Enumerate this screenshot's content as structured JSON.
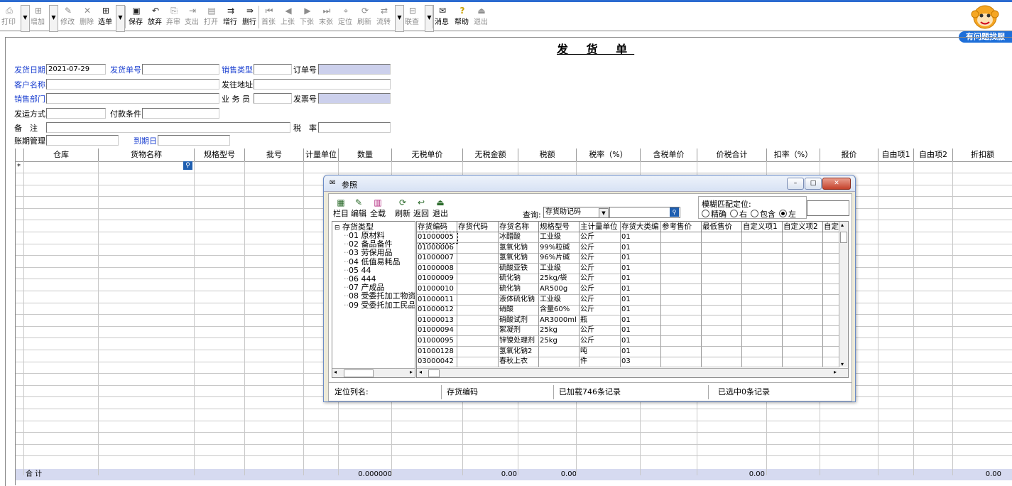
{
  "toolbar": {
    "buttons": [
      {
        "id": "print",
        "label": "打印",
        "icon": "printer-icon",
        "enabled": false
      },
      {
        "id": "add",
        "label": "增加",
        "icon": "add-doc-icon",
        "enabled": false
      },
      {
        "id": "modify",
        "label": "修改",
        "icon": "edit-icon",
        "enabled": false
      },
      {
        "id": "delete",
        "label": "删除",
        "icon": "delete-icon",
        "enabled": false
      },
      {
        "id": "select",
        "label": "选单",
        "icon": "select-icon",
        "enabled": true
      },
      {
        "id": "save",
        "label": "保存",
        "icon": "save-icon",
        "enabled": true
      },
      {
        "id": "abandon",
        "label": "放弃",
        "icon": "undo-icon",
        "enabled": true
      },
      {
        "id": "abandon_audit",
        "label": "弃审",
        "icon": "unaudit-icon",
        "enabled": false
      },
      {
        "id": "pay",
        "label": "支出",
        "icon": "pay-icon",
        "enabled": false
      },
      {
        "id": "open",
        "label": "打开",
        "icon": "open-icon",
        "enabled": false
      },
      {
        "id": "add_row",
        "label": "增行",
        "icon": "add-row-icon",
        "enabled": true
      },
      {
        "id": "del_row",
        "label": "删行",
        "icon": "del-row-icon",
        "enabled": true
      },
      {
        "id": "first",
        "label": "首张",
        "icon": "first-icon",
        "enabled": false
      },
      {
        "id": "prev",
        "label": "上张",
        "icon": "prev-icon",
        "enabled": false
      },
      {
        "id": "next",
        "label": "下张",
        "icon": "next-icon",
        "enabled": false
      },
      {
        "id": "last",
        "label": "末张",
        "icon": "last-icon",
        "enabled": false
      },
      {
        "id": "locate",
        "label": "定位",
        "icon": "locate-icon",
        "enabled": false
      },
      {
        "id": "refresh",
        "label": "刷新",
        "icon": "refresh-icon",
        "enabled": false
      },
      {
        "id": "flow",
        "label": "流转",
        "icon": "flow-icon",
        "enabled": false
      },
      {
        "id": "link",
        "label": "联查",
        "icon": "link-query-icon",
        "enabled": false
      },
      {
        "id": "message",
        "label": "消息",
        "icon": "message-icon",
        "enabled": true
      },
      {
        "id": "help",
        "label": "帮助",
        "icon": "help-icon",
        "enabled": true
      },
      {
        "id": "exit",
        "label": "退出",
        "icon": "exit-icon",
        "enabled": false
      }
    ],
    "help_link": "有问题找服"
  },
  "form": {
    "title": "发 货 单",
    "fields": {
      "ship_date_label": "发货日期",
      "ship_date": "2021-07-29",
      "ship_no_label": "发货单号",
      "sales_type_label": "销售类型",
      "order_no_label": "订单号",
      "customer_label": "客户名称",
      "ship_addr_label": "发往地址",
      "sales_dept_label": "销售部门",
      "salesman_label": "业 务 员",
      "invoice_no_label": "发票号",
      "ship_method_label": "发运方式",
      "pay_terms_label": "付款条件",
      "remark_label": "备　注",
      "tax_rate_label": "税　率",
      "period_mgmt_label": "账期管理",
      "due_date_label": "到期日"
    }
  },
  "grid": {
    "columns": [
      "仓库",
      "货物名称",
      "规格型号",
      "批号",
      "计量单位",
      "数量",
      "无税单价",
      "无税金额",
      "税额",
      "税率（%）",
      "含税单价",
      "价税合计",
      "扣率（%）",
      "报价",
      "自由项1",
      "自由项2",
      "折扣额"
    ],
    "new_row_marker": "*",
    "total_label": "合 计",
    "totals": {
      "qty": "0.000000",
      "amount": "0.00",
      "tax": "0.00",
      "total": "0.00",
      "discount": "0.00"
    }
  },
  "dialog": {
    "title": "参照",
    "toolbar": [
      {
        "label": "栏目",
        "icon": "columns-icon"
      },
      {
        "label": "编辑",
        "icon": "edit-icon"
      },
      {
        "label": "全载",
        "icon": "load-all-icon"
      },
      {
        "label": "刷新",
        "icon": "refresh-icon"
      },
      {
        "label": "返回",
        "icon": "return-icon"
      },
      {
        "label": "退出",
        "icon": "exit-icon"
      }
    ],
    "query_label": "查询:",
    "query_select": "存货助记码",
    "fuzzy_label": "模糊匹配定位:",
    "radio_options": [
      "精确",
      "右",
      "包含",
      "左"
    ],
    "radio_selected": "左",
    "tree": {
      "root": "存货类型",
      "items": [
        "01 原材料",
        "02 备品备件",
        "03 劳保用品",
        "04 低值易耗品",
        "05 44",
        "06 444",
        "07 产成品",
        "08 受委托加工物资",
        "09 受委托加工民品"
      ]
    },
    "columns": [
      "存货编码",
      "存货代码",
      "存货名称",
      "规格型号",
      "主计量单位",
      "存货大类编",
      "参考售价",
      "最低售价",
      "自定义项1",
      "自定义项2",
      "自定"
    ],
    "rows": [
      [
        "01000005",
        "",
        "冰醋酸",
        "工业级",
        "公斤",
        "01"
      ],
      [
        "01000006",
        "",
        "氢氧化钠",
        "99%粒碱",
        "公斤",
        "01"
      ],
      [
        "01000007",
        "",
        "氢氧化钠",
        "96%片碱",
        "公斤",
        "01"
      ],
      [
        "01000008",
        "",
        "硫酸亚铁",
        "工业级",
        "公斤",
        "01"
      ],
      [
        "01000009",
        "",
        "硫化钠",
        "25kg/袋",
        "公斤",
        "01"
      ],
      [
        "01000010",
        "",
        "硫化钠",
        "AR500g",
        "公斤",
        "01"
      ],
      [
        "01000011",
        "",
        "液体硫化钠",
        "工业级",
        "公斤",
        "01"
      ],
      [
        "01000012",
        "",
        "硝酸",
        "含量60%",
        "公斤",
        "01"
      ],
      [
        "01000013",
        "",
        "硝酸试剂",
        "AR3000ml",
        "瓶",
        "01"
      ],
      [
        "01000094",
        "",
        "絮凝剂",
        "25kg",
        "公斤",
        "01"
      ],
      [
        "01000095",
        "",
        "锌镍处理剂",
        "25kg",
        "公斤",
        "01"
      ],
      [
        "01000128",
        "",
        "氢氧化钠2",
        "",
        "吨",
        "01"
      ],
      [
        "03000042",
        "",
        "春秋上衣",
        "",
        "件",
        "03"
      ]
    ],
    "status": {
      "locate_label": "定位列名:",
      "locate_col": "存货编码",
      "loaded": "已加载746条记录",
      "selected": "已选中0条记录"
    }
  }
}
